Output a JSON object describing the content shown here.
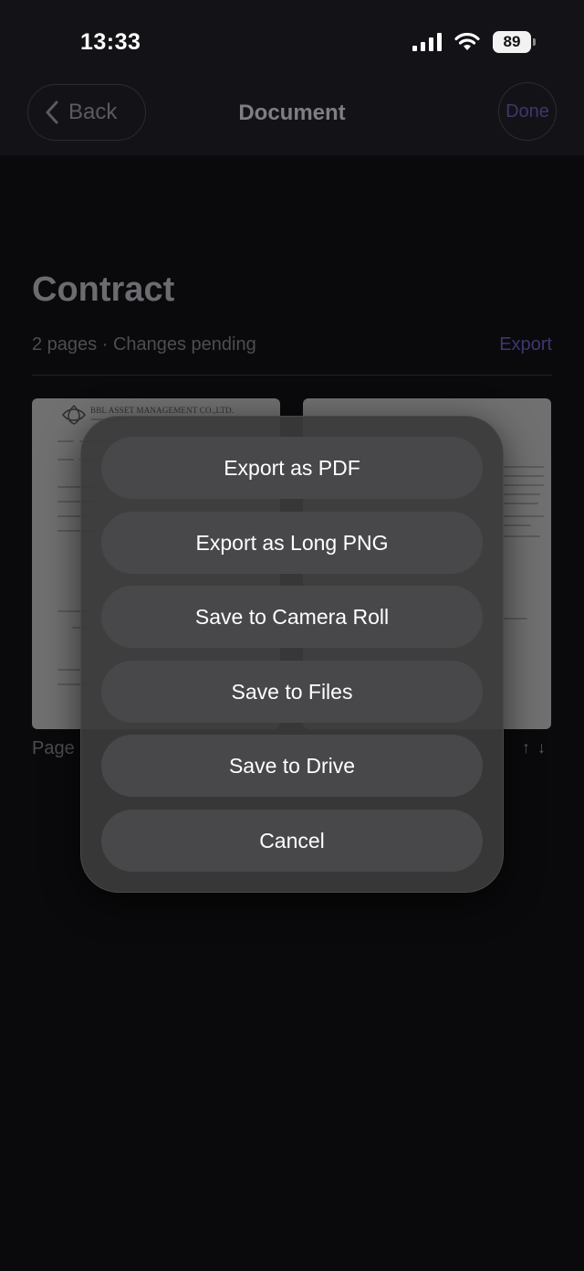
{
  "status_bar": {
    "time": "13:33",
    "battery": "89"
  },
  "nav": {
    "back_label": "Back",
    "title": "Document",
    "done_label": "Done"
  },
  "document": {
    "title": "Contract",
    "meta": "2 pages · Changes pending",
    "export_label": "Export",
    "page_label": "Page",
    "thumb_heading": "BBL ASSET MANAGEMENT CO.,LTD."
  },
  "action_sheet": {
    "export_pdf": "Export as PDF",
    "export_png": "Export as Long PNG",
    "save_camera_roll": "Save to Camera Roll",
    "save_files": "Save to Files",
    "save_drive": "Save to Drive",
    "cancel": "Cancel"
  },
  "icons": {
    "back": "chevron-left-icon",
    "signal": "cellular-signal-icon",
    "wifi": "wifi-icon",
    "battery": "battery-icon",
    "up": "arrow-up-icon",
    "down": "arrow-down-icon"
  },
  "colors": {
    "accent": "#3d3770",
    "background": "#0a0a0c",
    "sheet": "#3a3a3c",
    "button": "#48484b"
  }
}
